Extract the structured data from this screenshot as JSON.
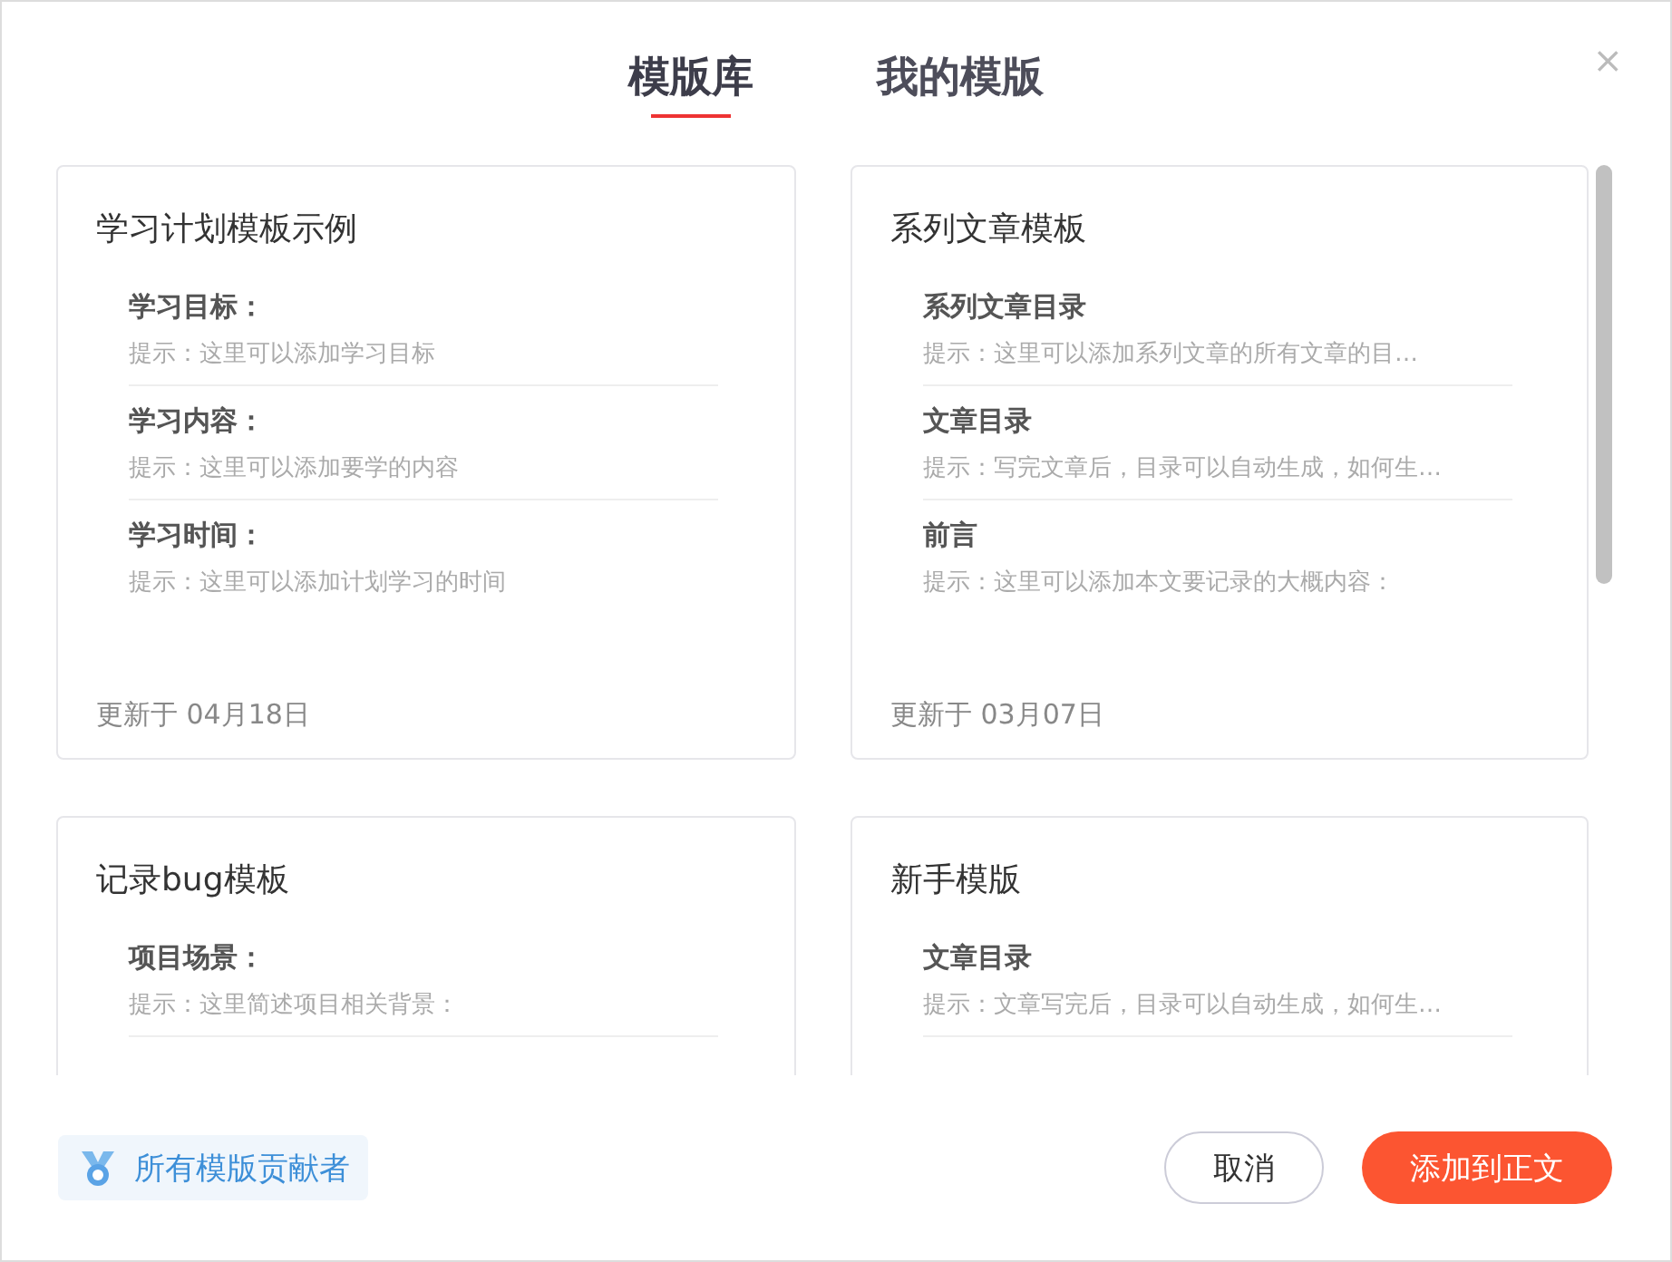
{
  "tabs": [
    {
      "label": "模版库",
      "selected": true
    },
    {
      "label": "我的模版",
      "selected": false
    }
  ],
  "close": "×",
  "templates": [
    {
      "title": "学习计划模板示例",
      "sections": [
        {
          "heading": "学习目标：",
          "hint": "提示：这里可以添加学习目标"
        },
        {
          "heading": "学习内容：",
          "hint": "提示：这里可以添加要学的内容"
        },
        {
          "heading": "学习时间：",
          "hint": "提示：这里可以添加计划学习的时间"
        }
      ],
      "updated": "更新于 04月18日"
    },
    {
      "title": "系列文章模板",
      "sections": [
        {
          "heading": "系列文章目录",
          "hint": "提示：这里可以添加系列文章的所有文章的目…"
        },
        {
          "heading": "文章目录",
          "hint": "提示：写完文章后，目录可以自动生成，如何生…"
        },
        {
          "heading": "前言",
          "hint": "提示：这里可以添加本文要记录的大概内容："
        }
      ],
      "updated": "更新于 03月07日"
    },
    {
      "title": "记录bug模板",
      "sections": [
        {
          "heading": "项目场景：",
          "hint": "提示：这里简述项目相关背景："
        }
      ]
    },
    {
      "title": "新手模版",
      "sections": [
        {
          "heading": "文章目录",
          "hint": "提示：文章写完后，目录可以自动生成，如何生…"
        }
      ]
    }
  ],
  "contributors": "所有模版贡献者",
  "buttons": [
    {
      "label": "取消",
      "kind": "secondary"
    },
    {
      "label": "添加到正文",
      "kind": "primary"
    }
  ]
}
